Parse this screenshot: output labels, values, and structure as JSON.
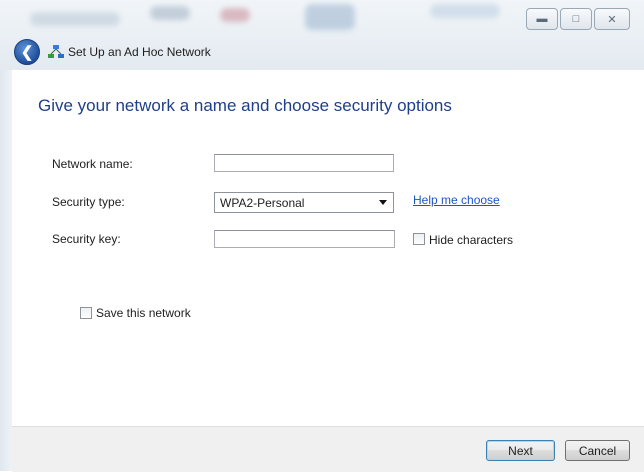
{
  "window": {
    "title": "Set Up an Ad Hoc Network",
    "controls": {
      "minimize_icon": "minimize-icon",
      "maximize_icon": "maximize-icon",
      "close_icon": "close-icon"
    }
  },
  "page": {
    "heading": "Give your network a name and choose security options"
  },
  "form": {
    "network_name": {
      "label": "Network name:",
      "value": ""
    },
    "security_type": {
      "label": "Security type:",
      "selected": "WPA2-Personal"
    },
    "help_link": "Help me choose",
    "security_key": {
      "label": "Security key:",
      "value": ""
    },
    "hide_characters": {
      "label": "Hide characters",
      "checked": false
    },
    "save_network": {
      "label": "Save this network",
      "checked": false
    }
  },
  "footer": {
    "next_label": "Next",
    "cancel_label": "Cancel"
  },
  "colors": {
    "heading": "#1e3f8a",
    "link": "#1a56c8",
    "footer_bg": "#f0f0f0"
  }
}
